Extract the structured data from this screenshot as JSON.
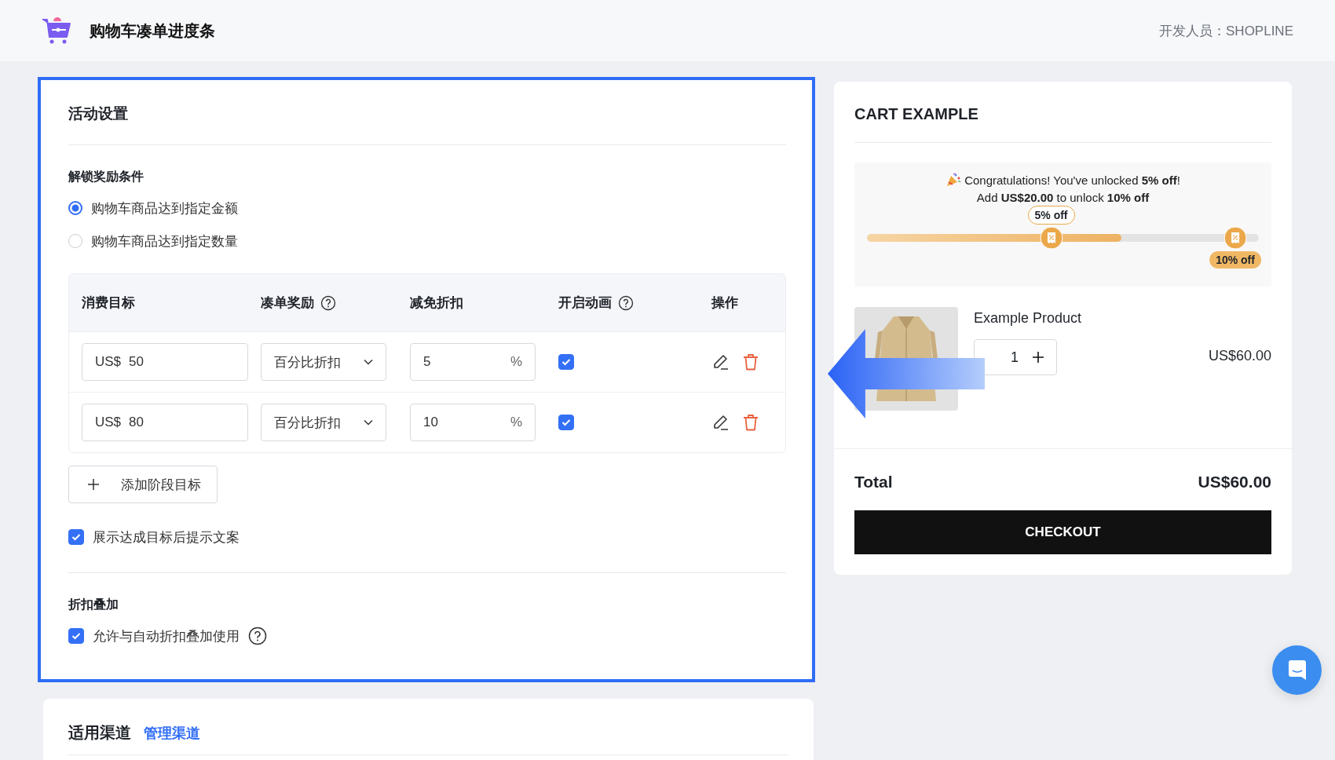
{
  "header": {
    "title": "购物车凑单进度条",
    "developer": "开发人员：SHOPLINE"
  },
  "settings": {
    "title": "活动设置",
    "condition_label": "解锁奖励条件",
    "conditions": [
      {
        "label": "购物车商品达到指定金额",
        "selected": true
      },
      {
        "label": "购物车商品达到指定数量",
        "selected": false
      }
    ],
    "table": {
      "columns": [
        {
          "label": "消费目标",
          "help": false
        },
        {
          "label": "凑单奖励",
          "help": true
        },
        {
          "label": "减免折扣",
          "help": false
        },
        {
          "label": "开启动画",
          "help": true
        },
        {
          "label": "操作",
          "help": false
        }
      ],
      "rows": [
        {
          "currency": "US$",
          "target": "50",
          "reward": "百分比折扣",
          "discount": "5",
          "unit": "%",
          "animation": true
        },
        {
          "currency": "US$",
          "target": "80",
          "reward": "百分比折扣",
          "discount": "10",
          "unit": "%",
          "animation": true
        }
      ]
    },
    "add_button": "添加阶段目标",
    "show_tip": {
      "label": "展示达成目标后提示文案",
      "checked": true
    },
    "stack_title": "折扣叠加",
    "stack": {
      "label": "允许与自动折扣叠加使用",
      "checked": true
    }
  },
  "channels": {
    "title": "适用渠道",
    "link": "管理渠道"
  },
  "cart": {
    "title": "CART EXAMPLE",
    "message": [
      "Congratulations! You've unlocked **5% off**!",
      "Add **US$20.00** to unlock **10% off**"
    ],
    "progress": {
      "level": 0.65
    },
    "milestones": [
      {
        "label": "5% off",
        "unlocked": true
      },
      {
        "label": "10% off",
        "unlocked": false
      }
    ],
    "product": {
      "name": "Example Product",
      "quantity": "1",
      "price": "US$60.00"
    },
    "total_label": "Total",
    "total": "US$60.00",
    "checkout": "CHECKOUT"
  }
}
